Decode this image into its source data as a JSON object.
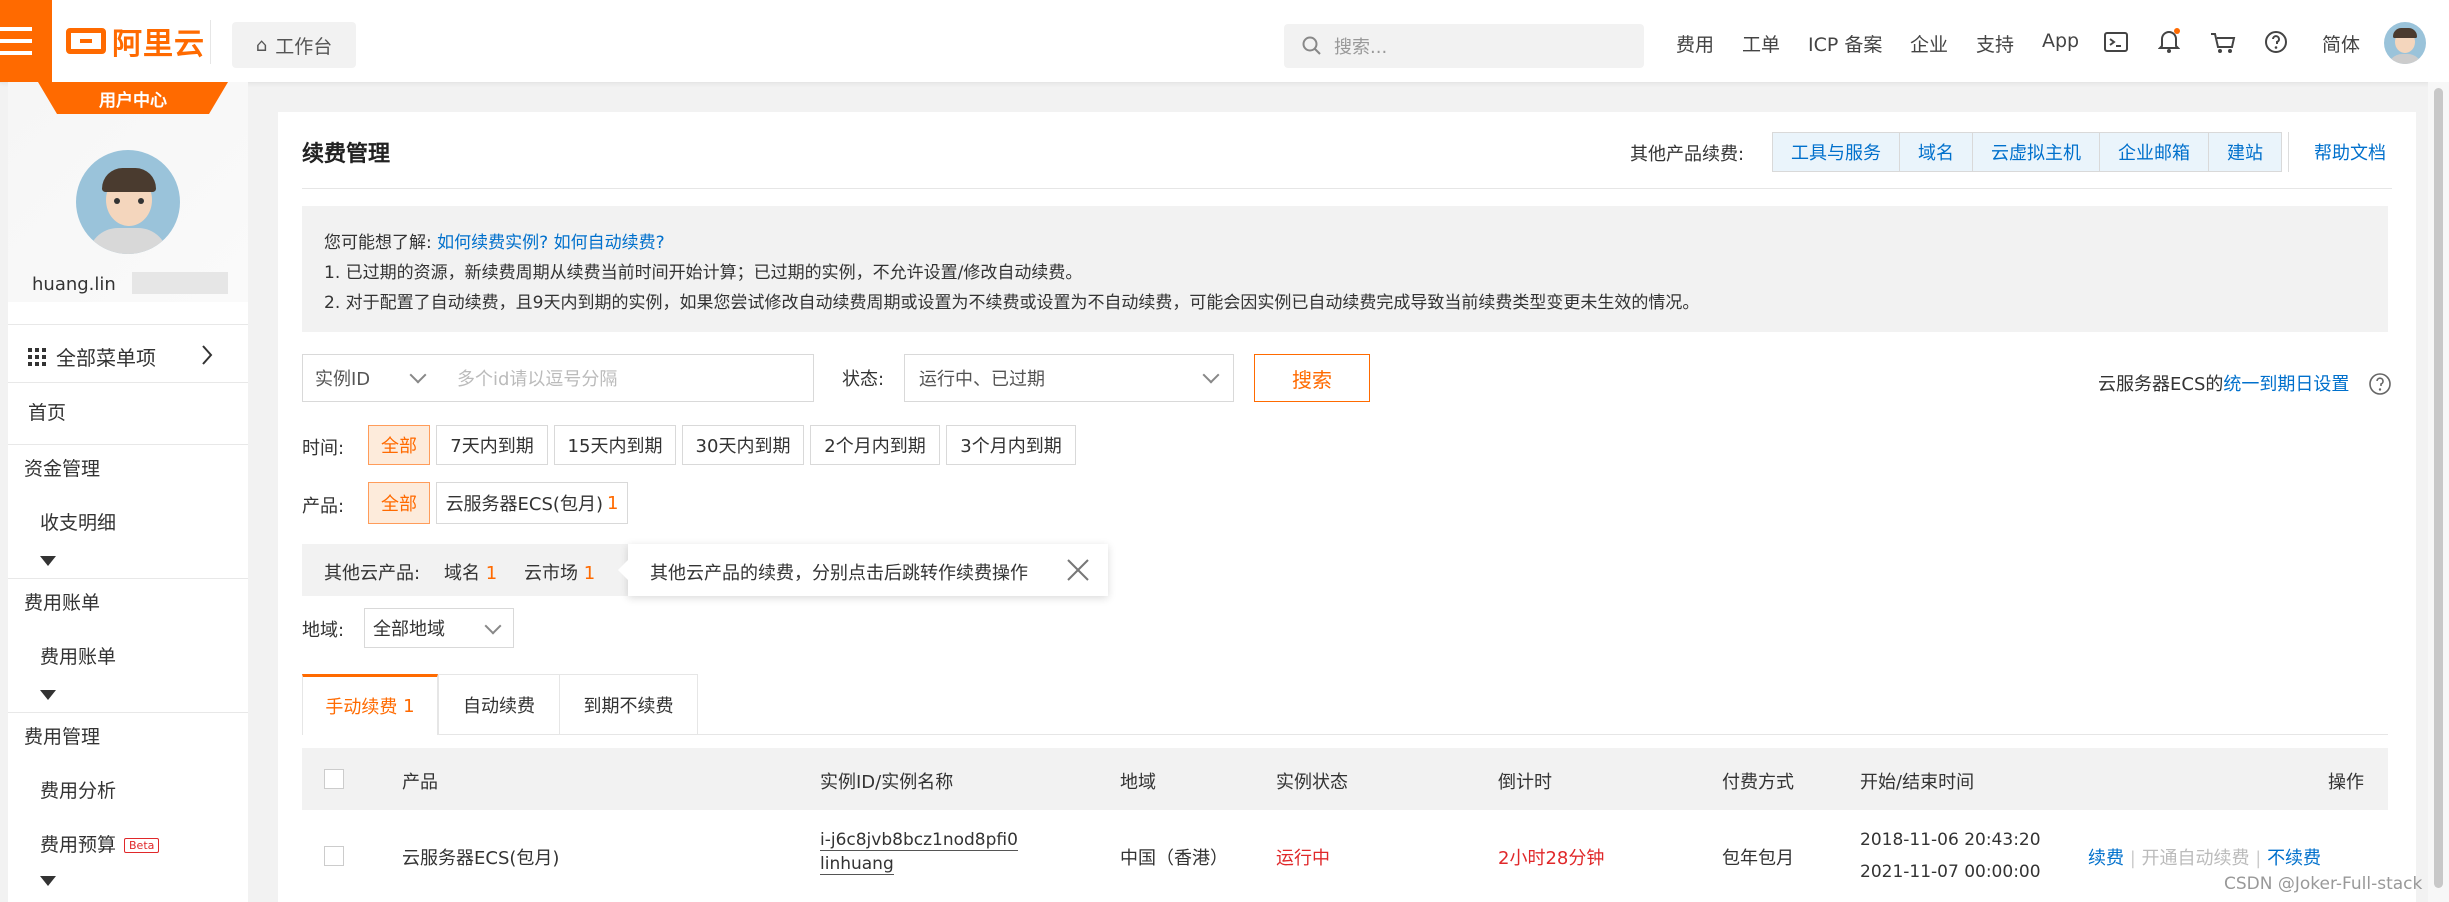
{
  "topbar": {
    "logo_text": "阿里云",
    "workbench_label": "工作台",
    "search_placeholder": "搜索...",
    "nav": [
      "费用",
      "工单",
      "ICP 备案",
      "企业",
      "支持",
      "App"
    ],
    "lang_label": "简体"
  },
  "sidebar": {
    "badge": "用户中心",
    "username": "huang.lin",
    "all_menu_label": "全部菜单项",
    "items": [
      {
        "label": "首页"
      },
      {
        "label": "资金管理",
        "sub": "收支明细"
      },
      {
        "label": "费用账单",
        "sub": "费用账单"
      },
      {
        "label": "费用管理",
        "sub": "费用分析",
        "sub2": "费用预算",
        "sub2_badge": "Beta"
      }
    ]
  },
  "page": {
    "title": "续费管理",
    "other_products_label": "其他产品续费:",
    "other_products": [
      "工具与服务",
      "域名",
      "云虚拟主机",
      "企业邮箱",
      "建站"
    ],
    "help_link": "帮助文档",
    "notice": {
      "prefix": "您可能想了解:",
      "link1": "如何续费实例?",
      "link2": "如何自动续费?",
      "line1": "1. 已过期的资源，新续费周期从续费当前时间开始计算；已过期的实例，不允许设置/修改自动续费。",
      "line2": "2. 对于配置了自动续费，且9天内到期的实例，如果您尝试修改自动续费周期或设置为不续费或设置为不自动续费，可能会因实例已自动续费完成导致当前续费类型变更未生效的情况。"
    },
    "filter": {
      "id_select": "实例ID",
      "id_placeholder": "多个id请以逗号分隔",
      "status_label": "状态:",
      "status_value": "运行中、已过期",
      "search_button": "搜索",
      "ecs_prefix": "云服务器ECS的",
      "ecs_link": "统一到期日设置"
    },
    "time": {
      "label": "时间:",
      "options": [
        "全部",
        "7天内到期",
        "15天内到期",
        "30天内到期",
        "2个月内到期",
        "3个月内到期"
      ]
    },
    "product": {
      "label": "产品:",
      "all": "全部",
      "ecs": "云服务器ECS(包月)",
      "ecs_count": "1"
    },
    "other_cloud": {
      "label": "其他云产品:",
      "domain": "域名",
      "domain_count": "1",
      "market": "云市场",
      "market_count": "1",
      "tooltip": "其他云产品的续费，分别点击后跳转作续费操作"
    },
    "region": {
      "label": "地域:",
      "value": "全部地域"
    },
    "tabs": {
      "manual": "手动续费",
      "manual_count": "1",
      "auto": "自动续费",
      "none": "到期不续费"
    },
    "table": {
      "headers": [
        "产品",
        "实例ID/实例名称",
        "地域",
        "实例状态",
        "倒计时",
        "付费方式",
        "开始/结束时间",
        "操作"
      ],
      "row": {
        "product": "云服务器ECS(包月)",
        "instance_id": "i-j6c8jvb8bcz1nod8pfi0",
        "instance_name": "linhuang",
        "region": "中国（香港）",
        "status": "运行中",
        "countdown": "2小时28分钟",
        "pay": "包年包月",
        "start": "2018-11-06 20:43:20",
        "end": "2021-11-07 00:00:00",
        "op_renew": "续费",
        "op_auto": "开通自动续费",
        "op_none": "不续费"
      }
    }
  },
  "watermark": "CSDN @Joker-Full-stack"
}
